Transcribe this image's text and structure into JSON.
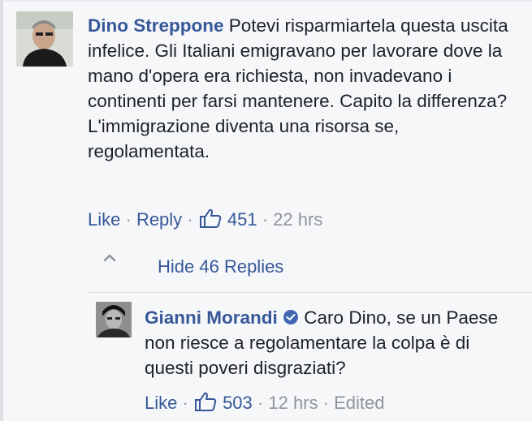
{
  "comment": {
    "author": "Dino Streppone",
    "text": "Potevi risparmiartela questa uscita infelice. Gli Italiani emigravano per lavorare dove la mano d'opera era richiesta, non invadevano i continenti per farsi mantenere. Capito la differenza? L'immigrazione diventa una risorsa se, regolamentata.",
    "like_label": "Like",
    "reply_label": "Reply",
    "like_count": "451",
    "time": "22 hrs"
  },
  "replies": {
    "toggle_label": "Hide 46 Replies"
  },
  "reply": {
    "author": "Gianni Morandi",
    "text": "Caro Dino, se un Paese non riesce a regolamentare la colpa è di questi poveri disgraziati?",
    "like_label": "Like",
    "like_count": "503",
    "time": "12 hrs",
    "edited_label": "Edited"
  },
  "colors": {
    "link": "#365899",
    "meta": "#90949c",
    "text": "#1d2129",
    "background": "#f6f7f9"
  },
  "icons": [
    "thumbs-up-icon",
    "caret-up-icon",
    "verified-badge-icon"
  ]
}
